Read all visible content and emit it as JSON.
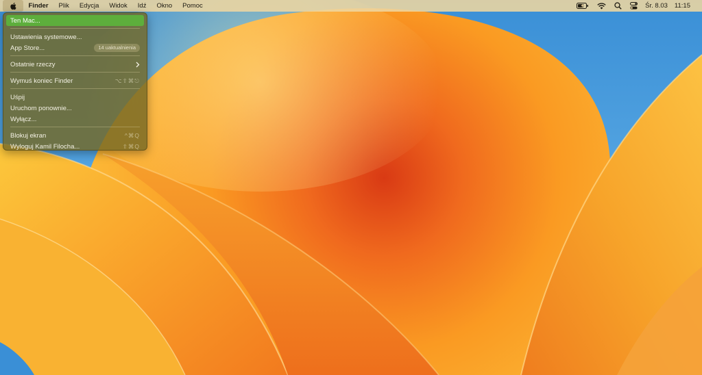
{
  "menubar": {
    "apple_icon": "apple-logo-icon",
    "app_name": "Finder",
    "menus": [
      "Plik",
      "Edycja",
      "Widok",
      "Idź",
      "Okno",
      "Pomoc"
    ],
    "status_icons": [
      "battery-icon",
      "wifi-icon",
      "search-icon",
      "control-center-icon"
    ],
    "date": "Śr. 8.03",
    "time": "11:15"
  },
  "apple_menu": {
    "items": [
      {
        "label": "Ten Mac...",
        "highlighted": true
      },
      {
        "label": "Ustawienia systemowe..."
      },
      {
        "label": "App Store...",
        "badge": "14 uaktualnienia"
      },
      {
        "label": "Ostatnie rzeczy",
        "submenu_icon": "chevron-right-icon"
      },
      {
        "label": "Wymuś koniec Finder",
        "shortcut": "⌥⇧⌘⎋"
      },
      {
        "label": "Uśpij"
      },
      {
        "label": "Uruchom ponownie..."
      },
      {
        "label": "Wyłącz..."
      },
      {
        "label": "Blokuj ekran",
        "shortcut": "^⌘Q"
      },
      {
        "label": "Wyloguj Kamil Filocha...",
        "shortcut": "⇧⌘Q"
      }
    ]
  },
  "colors": {
    "highlight": "#5dae3c",
    "wallpaper_orange": "#f59a1c",
    "wallpaper_red": "#e2481b",
    "wallpaper_blue": "#3a8fd6"
  }
}
